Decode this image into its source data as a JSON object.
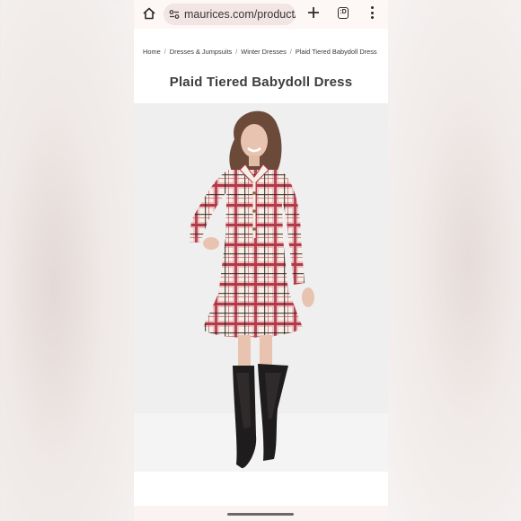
{
  "browser": {
    "url": "maurices.com/product/p",
    "tab_count": ":D"
  },
  "breadcrumb": {
    "items": [
      "Home",
      "Dresses & Jumpsuits",
      "Winter Dresses",
      "Plaid Tiered Babydoll Dress"
    ],
    "separator": "/"
  },
  "product": {
    "title": "Plaid Tiered Babydoll Dress"
  },
  "colors": {
    "plaid_red": "#b23a48",
    "plaid_pink": "#e8b4b8",
    "plaid_cream": "#f5efe6",
    "boots": "#1e1c1c"
  }
}
